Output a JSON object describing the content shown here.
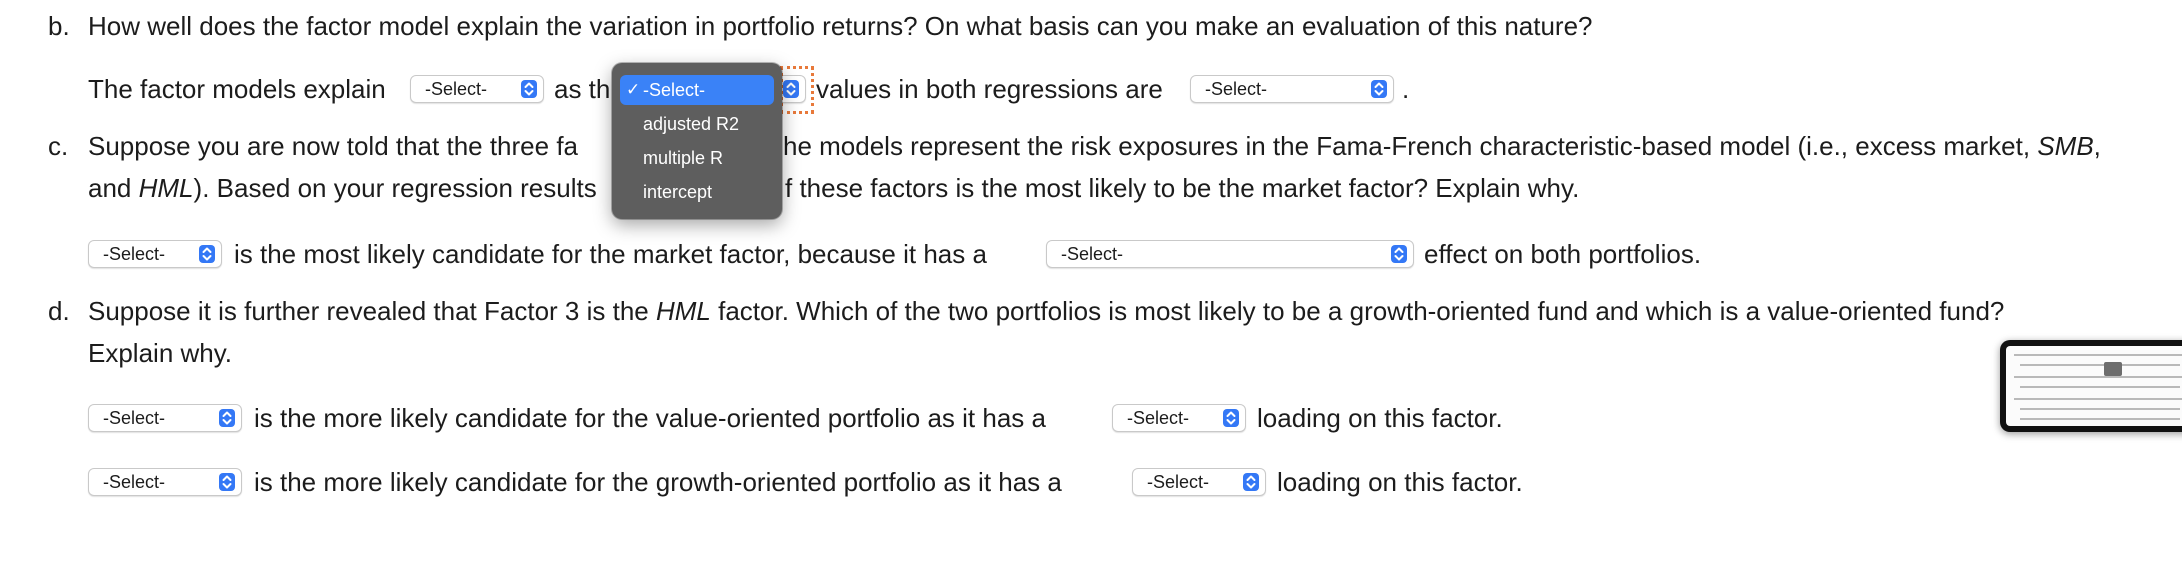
{
  "colors": {
    "select_button": "#3478f6",
    "menu_bg": "#5e5e5e",
    "menu_highlight": "#3a82f7",
    "focus_ring": "#e8793a"
  },
  "select_placeholder": "-Select-",
  "q_b": {
    "marker": "b.",
    "question": "How well does the factor model explain the variation in portfolio returns? On what basis can you make an evaluation of this nature?",
    "answer": {
      "text1": "The factor models explain",
      "text2": "as th",
      "text3": "values in both regressions are",
      "text4": "."
    }
  },
  "q_c": {
    "marker": "c.",
    "question_line1_a": "Suppose you are now told that the three fa",
    "question_line1_b": "he models represent the risk exposures in the Fama-French characteristic-based model (i.e., excess market,",
    "question_line1_c": "SMB",
    "question_line1_d": ",",
    "question_line2_a": "and",
    "question_line2_b": "HML",
    "question_line2_c": "). Based on your regression results",
    "question_line2_d": "f these factors is the most likely to be the market factor? Explain why.",
    "answer": {
      "text1": "is the most likely candidate for the market factor, because it has a",
      "text2": "effect on both portfolios."
    }
  },
  "q_d": {
    "marker": "d.",
    "question_line1_a": "Suppose it is further revealed that Factor 3 is the",
    "question_line1_b": "HML",
    "question_line1_c": "factor. Which of the two portfolios is most likely to be a growth-oriented fund and which is a value-oriented fund?",
    "question_line2": "Explain why.",
    "answer1": {
      "text1": "is the more likely candidate for the value-oriented portfolio as it has a",
      "text2": "loading on this factor."
    },
    "answer2": {
      "text1": "is the more likely candidate for the growth-oriented portfolio as it has a",
      "text2": "loading on this factor."
    }
  },
  "dropdown_menu": {
    "items": [
      {
        "label": "-Select-",
        "checked": true
      },
      {
        "label": "adjusted R2",
        "checked": false
      },
      {
        "label": "multiple R",
        "checked": false
      },
      {
        "label": "intercept",
        "checked": false
      }
    ],
    "checkmark": "✓"
  }
}
